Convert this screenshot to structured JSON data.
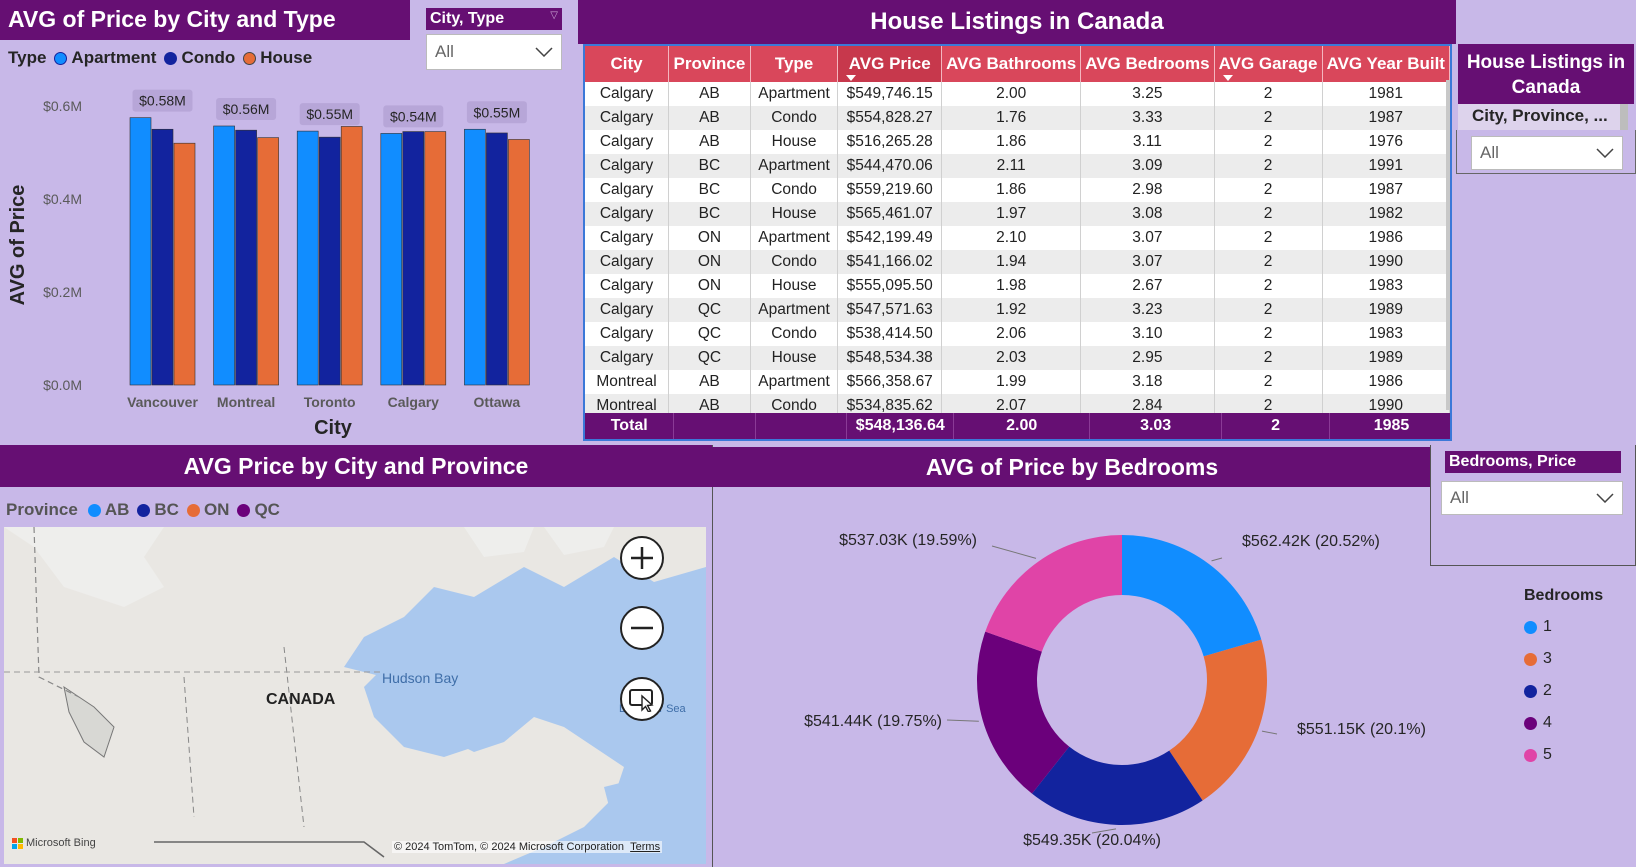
{
  "bar_chart": {
    "title": "AVG of Price by City and Type",
    "legend_label": "Type",
    "ylabel": "AVG of Price",
    "xlabel": "City",
    "yticks": [
      "$0.6M",
      "$0.4M",
      "$0.2M",
      "$0.0M"
    ],
    "series_colors": [
      "#118dff",
      "#12239e",
      "#e66c37"
    ]
  },
  "chart_data": [
    {
      "type": "bar",
      "title": "AVG of Price by City and Type",
      "xlabel": "City",
      "ylabel": "AVG of Price",
      "ylim": [
        0,
        0.6
      ],
      "categories": [
        "Vancouver",
        "Montreal",
        "Toronto",
        "Calgary",
        "Ottawa"
      ],
      "series": [
        {
          "name": "Apartment",
          "values": [
            0.575,
            0.557,
            0.546,
            0.541,
            0.55
          ]
        },
        {
          "name": "Condo",
          "values": [
            0.55,
            0.548,
            0.533,
            0.545,
            0.542
          ]
        },
        {
          "name": "House",
          "values": [
            0.52,
            0.532,
            0.556,
            0.545,
            0.528
          ]
        }
      ],
      "data_labels": [
        "$0.58M",
        "$0.56M",
        "$0.55M",
        "$0.54M",
        "$0.55M"
      ],
      "legend": "top-left"
    },
    {
      "type": "pie",
      "title": "AVG of Price by Bedrooms",
      "legend_title": "Bedrooms",
      "slices": [
        {
          "label": "1",
          "value": 562.42,
          "pct": 20.52,
          "text": "$562.42K (20.52%)",
          "color": "#118dff"
        },
        {
          "label": "3",
          "value": 551.15,
          "pct": 20.1,
          "text": "$551.15K (20.1%)",
          "color": "#e66c37"
        },
        {
          "label": "2",
          "value": 549.35,
          "pct": 20.04,
          "text": "$549.35K (20.04%)",
          "color": "#12239e"
        },
        {
          "label": "4",
          "value": 541.44,
          "pct": 19.75,
          "text": "$541.44K (19.75%)",
          "color": "#6b007b"
        },
        {
          "label": "5",
          "value": 537.03,
          "pct": 19.59,
          "text": "$537.03K (19.59%)",
          "color": "#e044a7"
        }
      ],
      "legend": "right"
    }
  ],
  "slicer_city_type": {
    "header": "City, Type",
    "value": "All"
  },
  "table": {
    "title": "House Listings in Canada",
    "columns": [
      "City",
      "Province",
      "Type",
      "AVG Price",
      "AVG Bathrooms",
      "AVG Bedrooms",
      "AVG Garage",
      "AVG Year Built"
    ],
    "rows": [
      [
        "Calgary",
        "AB",
        "Apartment",
        "$549,746.15",
        "2.00",
        "3.25",
        "2",
        "1981"
      ],
      [
        "Calgary",
        "AB",
        "Condo",
        "$554,828.27",
        "1.76",
        "3.33",
        "2",
        "1987"
      ],
      [
        "Calgary",
        "AB",
        "House",
        "$516,265.28",
        "1.86",
        "3.11",
        "2",
        "1976"
      ],
      [
        "Calgary",
        "BC",
        "Apartment",
        "$544,470.06",
        "2.11",
        "3.09",
        "2",
        "1991"
      ],
      [
        "Calgary",
        "BC",
        "Condo",
        "$559,219.60",
        "1.86",
        "2.98",
        "2",
        "1987"
      ],
      [
        "Calgary",
        "BC",
        "House",
        "$565,461.07",
        "1.97",
        "3.08",
        "2",
        "1982"
      ],
      [
        "Calgary",
        "ON",
        "Apartment",
        "$542,199.49",
        "2.10",
        "3.07",
        "2",
        "1986"
      ],
      [
        "Calgary",
        "ON",
        "Condo",
        "$541,166.02",
        "1.94",
        "3.07",
        "2",
        "1990"
      ],
      [
        "Calgary",
        "ON",
        "House",
        "$555,095.50",
        "1.98",
        "2.67",
        "2",
        "1983"
      ],
      [
        "Calgary",
        "QC",
        "Apartment",
        "$547,571.63",
        "1.92",
        "3.23",
        "2",
        "1989"
      ],
      [
        "Calgary",
        "QC",
        "Condo",
        "$538,414.50",
        "2.06",
        "3.10",
        "2",
        "1983"
      ],
      [
        "Calgary",
        "QC",
        "House",
        "$548,534.38",
        "2.03",
        "2.95",
        "2",
        "1989"
      ],
      [
        "Montreal",
        "AB",
        "Apartment",
        "$566,358.67",
        "1.99",
        "3.18",
        "2",
        "1986"
      ],
      [
        "Montreal",
        "AB",
        "Condo",
        "$534,835.62",
        "2.07",
        "2.84",
        "2",
        "1990"
      ]
    ],
    "total": [
      "Total",
      "",
      "",
      "$548,136.64",
      "2.00",
      "3.03",
      "2",
      "1985"
    ]
  },
  "right_slicer": {
    "title": "House Listings in Canada",
    "header": "City, Province, ...",
    "value": "All"
  },
  "map": {
    "title": "AVG Price by City and Province",
    "legend_label": "Province",
    "legend": [
      {
        "name": "AB",
        "color": "#118dff"
      },
      {
        "name": "BC",
        "color": "#12239e"
      },
      {
        "name": "ON",
        "color": "#e66c37"
      },
      {
        "name": "QC",
        "color": "#6b007b"
      }
    ],
    "labels": {
      "country": "CANADA",
      "bay": "Hudson Bay",
      "sea": "Labrador Sea"
    },
    "attribution": "© 2024 TomTom, © 2024 Microsoft Corporation",
    "terms": "Terms",
    "bing": "Microsoft Bing"
  },
  "donut": {
    "title": "AVG of Price by Bedrooms",
    "legend_title": "Bedrooms"
  },
  "slicer_bedrooms": {
    "header": "Bedrooms, Price",
    "value": "All"
  }
}
